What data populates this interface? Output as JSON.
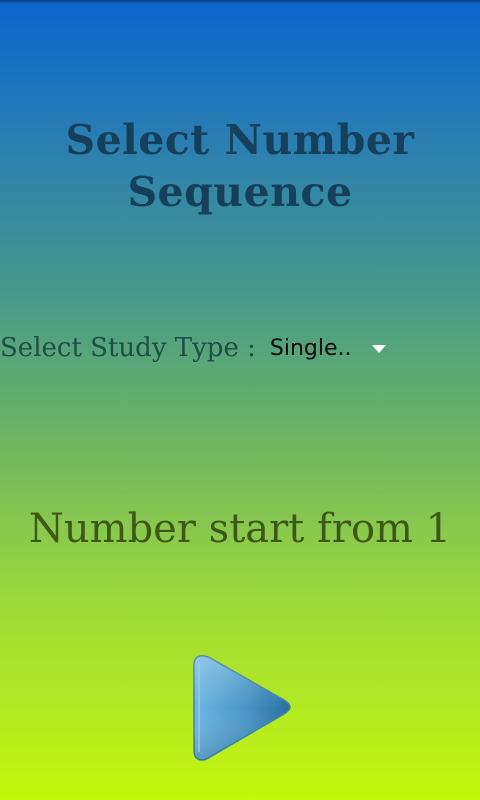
{
  "header": {
    "title_line1": "Select Number",
    "title_line2": "Sequence"
  },
  "study": {
    "label": "Select Study Type :",
    "selected": "Single.."
  },
  "sequence": {
    "start_text": "Number start from 1"
  },
  "play": {
    "icon": "play-icon"
  },
  "colors": {
    "gradient_top": "#0a66cf",
    "gradient_bottom": "#c4f70d",
    "title": "#163f5c",
    "play_button": "#3e8fc1"
  }
}
